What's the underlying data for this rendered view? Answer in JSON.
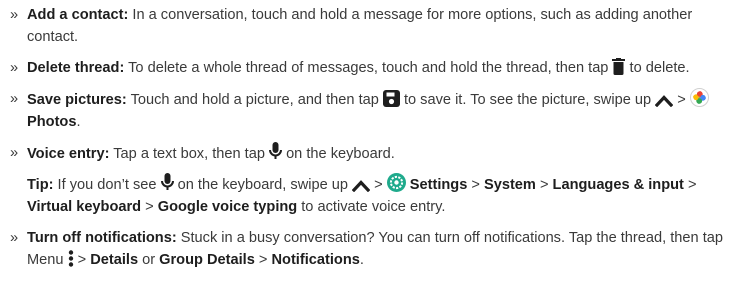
{
  "bullet_glyph": "»",
  "items": [
    {
      "title": "Add a contact:",
      "text": " In a conversation, touch and hold a message for more options, such as adding another contact."
    },
    {
      "title": "Delete thread:",
      "text_a": " To delete a whole thread of messages, touch and hold the thread, then tap ",
      "icon": "trash-icon",
      "text_b": " to delete."
    },
    {
      "title": "Save pictures:",
      "text_a": " Touch and hold a picture, and then tap ",
      "icon_a": "save-icon",
      "text_b": " to save it. To see the picture, swipe up ",
      "icon_b": "chevron-up-icon",
      "text_c": " > ",
      "icon_c": "photos-icon",
      "text_d": " ",
      "link": "Photos",
      "text_e": "."
    },
    {
      "title": "Voice entry:",
      "text_a": " Tap a text box, then tap ",
      "icon": "microphone-icon",
      "text_b": " on the keyboard."
    }
  ],
  "tip": {
    "title": "Tip:",
    "text_a": " If you don’t see ",
    "icon_a": "microphone-icon",
    "text_b": " on the keyboard, swipe up ",
    "icon_b": "chevron-up-icon",
    "text_c": " > ",
    "icon_c": "settings-icon",
    "text_d": " ",
    "settings": "Settings",
    "sep1": " > ",
    "system": "System",
    "sep2": " > ",
    "languages": "Languages & input",
    "sep3": " > ",
    "virtual": "Virtual keyboard",
    "sep4": " > ",
    "google": "Google voice typing",
    "text_e": " to activate voice entry."
  },
  "last_item": {
    "title": "Turn off notifications:",
    "text_a": " Stuck in a busy conversation? You can turn off notifications. Tap the thread, then tap Menu ",
    "icon": "more-vert-icon",
    "text_b": " > ",
    "details": "Details",
    "or": " or ",
    "group_details": "Group Details",
    "sep": " > ",
    "notifications": "Notifications",
    "end": "."
  },
  "colors": {
    "text": "#3a3a3a",
    "icon": "#1e1e1e",
    "settings_green": "#1faa8c"
  }
}
